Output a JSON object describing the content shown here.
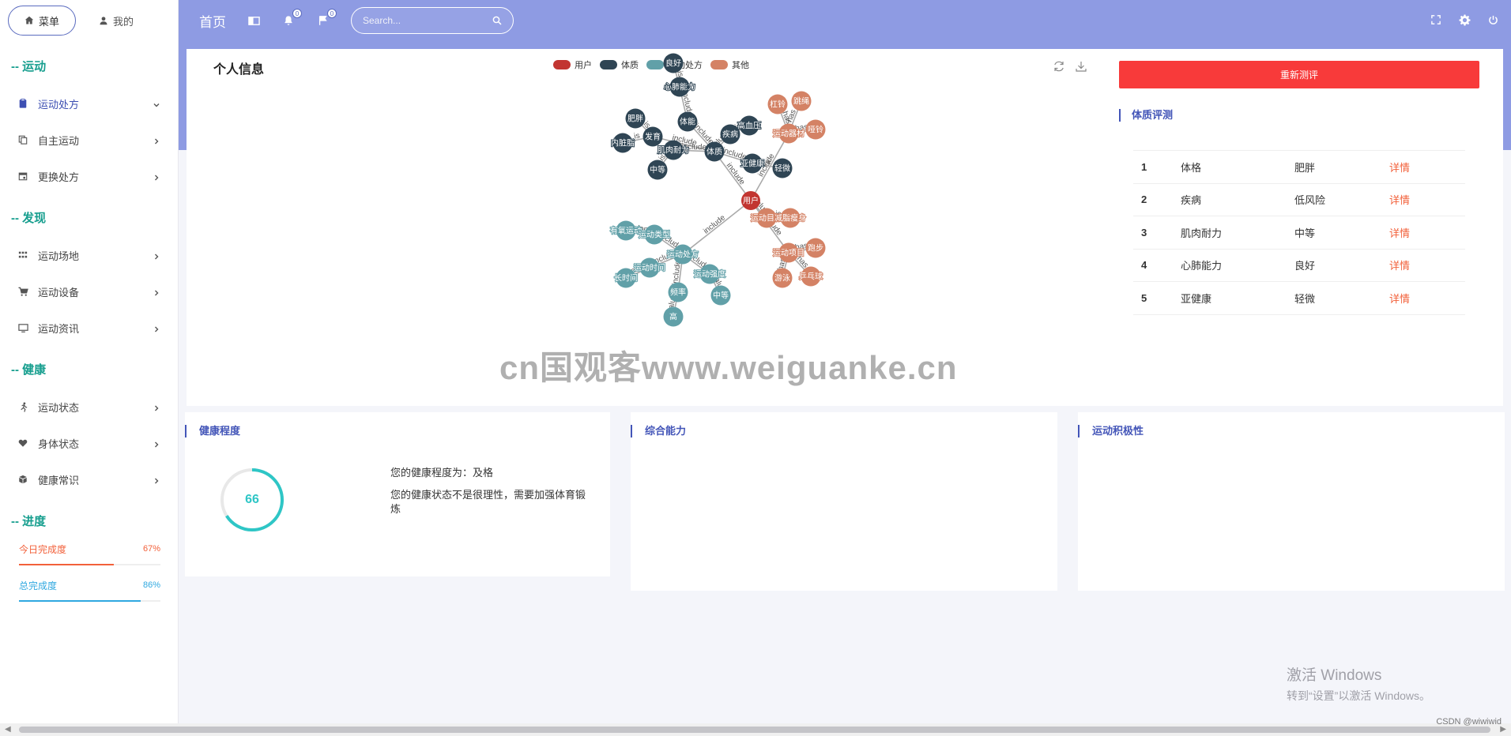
{
  "sidebar": {
    "tabs": [
      {
        "label": "菜单"
      },
      {
        "label": "我的"
      }
    ],
    "sections": [
      {
        "title": "-- 运动",
        "items": [
          {
            "label": "运动处方",
            "open": true
          },
          {
            "label": "自主运动"
          },
          {
            "label": "更换处方"
          }
        ]
      },
      {
        "title": "-- 发现",
        "items": [
          {
            "label": "运动场地"
          },
          {
            "label": "运动设备"
          },
          {
            "label": "运动资讯"
          }
        ]
      },
      {
        "title": "-- 健康",
        "items": [
          {
            "label": "运动状态"
          },
          {
            "label": "身体状态"
          },
          {
            "label": "健康常识"
          }
        ]
      },
      {
        "title": "-- 进度"
      }
    ],
    "progress": [
      {
        "label": "今日完成度",
        "value": "67%",
        "fraction": 0.67,
        "color": "#f2603a"
      },
      {
        "label": "总完成度",
        "value": "86%",
        "fraction": 0.86,
        "color": "#2fa8e0"
      }
    ]
  },
  "header": {
    "home": "首页",
    "notif_badge": "0",
    "flag_badge": "0",
    "search_placeholder": "Search..."
  },
  "graph": {
    "title": "个人信息",
    "legend": [
      {
        "name": "用户",
        "color": "#c23531"
      },
      {
        "name": "体质",
        "color": "#2f4554"
      },
      {
        "name": "运动处方",
        "color": "#61a0a8"
      },
      {
        "name": "其他",
        "color": "#d48265"
      }
    ],
    "nodes": [
      {
        "id": "yonghu",
        "label": "用户",
        "cat": 0
      },
      {
        "id": "tizhi",
        "label": "体质",
        "cat": 1
      },
      {
        "id": "tineng",
        "label": "体能",
        "cat": 1
      },
      {
        "id": "liangh",
        "label": "良好",
        "cat": 1
      },
      {
        "id": "xinfei",
        "label": "心肺能力",
        "cat": 1
      },
      {
        "id": "feipang",
        "label": "肥胖",
        "cat": 1
      },
      {
        "id": "fayu",
        "label": "发育",
        "cat": 1
      },
      {
        "id": "neizang",
        "label": "内脏脂",
        "cat": 1
      },
      {
        "id": "jirou",
        "label": "肌肉耐力",
        "cat": 1
      },
      {
        "id": "zhongdeng",
        "label": "中等",
        "cat": 1
      },
      {
        "id": "jibing",
        "label": "疾病",
        "cat": 1
      },
      {
        "id": "gaoxueya",
        "label": "高血压",
        "cat": 1
      },
      {
        "id": "yajk",
        "label": "亚健康",
        "cat": 1
      },
      {
        "id": "qingwei",
        "label": "轻微",
        "cat": 1
      },
      {
        "id": "chufang",
        "label": "运动处方",
        "cat": 2
      },
      {
        "id": "youyang",
        "label": "有氧运动",
        "cat": 2
      },
      {
        "id": "leixing",
        "label": "运动类型",
        "cat": 2
      },
      {
        "id": "shijian",
        "label": "运动时间",
        "cat": 2
      },
      {
        "id": "changshi",
        "label": "长时间",
        "cat": 2
      },
      {
        "id": "qiangdu",
        "label": "运动强度",
        "cat": 2
      },
      {
        "id": "pinlv",
        "label": "频率",
        "cat": 2
      },
      {
        "id": "zhong2",
        "label": "中等",
        "cat": 2
      },
      {
        "id": "gao",
        "label": "高",
        "cat": 2
      },
      {
        "id": "qicai",
        "label": "运动器材",
        "cat": 3
      },
      {
        "id": "ganling",
        "label": "杠铃",
        "cat": 3
      },
      {
        "id": "tiaosheng",
        "label": "跳绳",
        "cat": 3
      },
      {
        "id": "yaling",
        "label": "哑铃",
        "cat": 3
      },
      {
        "id": "mubiao",
        "label": "运动目标",
        "cat": 3
      },
      {
        "id": "jianfei",
        "label": "减脂瘦身",
        "cat": 3
      },
      {
        "id": "xiangmu",
        "label": "运动项目",
        "cat": 3
      },
      {
        "id": "paobu",
        "label": "跑步",
        "cat": 3
      },
      {
        "id": "youyong",
        "label": "游泳",
        "cat": 3
      },
      {
        "id": "pingpang",
        "label": "乒乓球",
        "cat": 3
      }
    ],
    "links": [
      {
        "s": "yonghu",
        "t": "tizhi",
        "label": "include"
      },
      {
        "s": "yonghu",
        "t": "chufang",
        "label": "include"
      },
      {
        "s": "yonghu",
        "t": "qicai",
        "label": "include"
      },
      {
        "s": "yonghu",
        "t": "mubiao",
        "label": "include"
      },
      {
        "s": "yonghu",
        "t": "xiangmu",
        "label": "include"
      },
      {
        "s": "tizhi",
        "t": "tineng",
        "label": "include"
      },
      {
        "s": "tizhi",
        "t": "jibing",
        "label": "include"
      },
      {
        "s": "tizhi",
        "t": "yajk",
        "label": "include"
      },
      {
        "s": "tizhi",
        "t": "fayu",
        "label": "include"
      },
      {
        "s": "tizhi",
        "t": "jirou",
        "label": "include"
      },
      {
        "s": "tineng",
        "t": "xinfei",
        "label": "include"
      },
      {
        "s": "xinfei",
        "t": "liangh",
        "label": "is"
      },
      {
        "s": "fayu",
        "t": "feipang",
        "label": "is"
      },
      {
        "s": "fayu",
        "t": "neizang",
        "label": "is"
      },
      {
        "s": "jirou",
        "t": "zhongdeng",
        "label": "is"
      },
      {
        "s": "jibing",
        "t": "gaoxueya",
        "label": "is"
      },
      {
        "s": "yajk",
        "t": "qingwei",
        "label": "is"
      },
      {
        "s": "chufang",
        "t": "leixing",
        "label": "include"
      },
      {
        "s": "leixing",
        "t": "youyang",
        "label": "belong"
      },
      {
        "s": "chufang",
        "t": "shijian",
        "label": "include"
      },
      {
        "s": "shijian",
        "t": "changshi",
        "label": "value"
      },
      {
        "s": "chufang",
        "t": "qiangdu",
        "label": "include"
      },
      {
        "s": "qiangdu",
        "t": "zhong2",
        "label": "value"
      },
      {
        "s": "chufang",
        "t": "pinlv",
        "label": "include"
      },
      {
        "s": "pinlv",
        "t": "gao",
        "label": "value"
      },
      {
        "s": "qicai",
        "t": "ganling",
        "label": "has"
      },
      {
        "s": "qicai",
        "t": "tiaosheng",
        "label": "has"
      },
      {
        "s": "qicai",
        "t": "yaling",
        "label": "has"
      },
      {
        "s": "mubiao",
        "t": "jianfei",
        "label": "is"
      },
      {
        "s": "xiangmu",
        "t": "paobu",
        "label": "has"
      },
      {
        "s": "xiangmu",
        "t": "youyong",
        "label": "has"
      },
      {
        "s": "xiangmu",
        "t": "pingpang",
        "label": "has"
      }
    ]
  },
  "watermark": "cn国观客www.weiguanke.cn",
  "right": {
    "button": "重新测评",
    "section": "体质评测",
    "rows": [
      {
        "no": "1",
        "item": "体格",
        "result": "肥胖",
        "link": "详情"
      },
      {
        "no": "2",
        "item": "疾病",
        "result": "低风险",
        "link": "详情"
      },
      {
        "no": "3",
        "item": "肌肉耐力",
        "result": "中等",
        "link": "详情"
      },
      {
        "no": "4",
        "item": "心肺能力",
        "result": "良好",
        "link": "详情"
      },
      {
        "no": "5",
        "item": "亚健康",
        "result": "轻微",
        "link": "详情"
      }
    ]
  },
  "panels": {
    "health": {
      "title": "健康程度",
      "score": "66",
      "score_value": 66,
      "score_max": 100,
      "line1": "您的健康程度为：及格",
      "line2": "您的健康状态不是很理性，需要加强体育锻炼"
    },
    "ability": {
      "title": "综合能力"
    },
    "activity": {
      "title": "运动积极性"
    }
  },
  "os": {
    "activate_title": "激活 Windows",
    "activate_sub": "转到“设置”以激活 Windows。",
    "csdn": "CSDN @wiwiwid"
  }
}
